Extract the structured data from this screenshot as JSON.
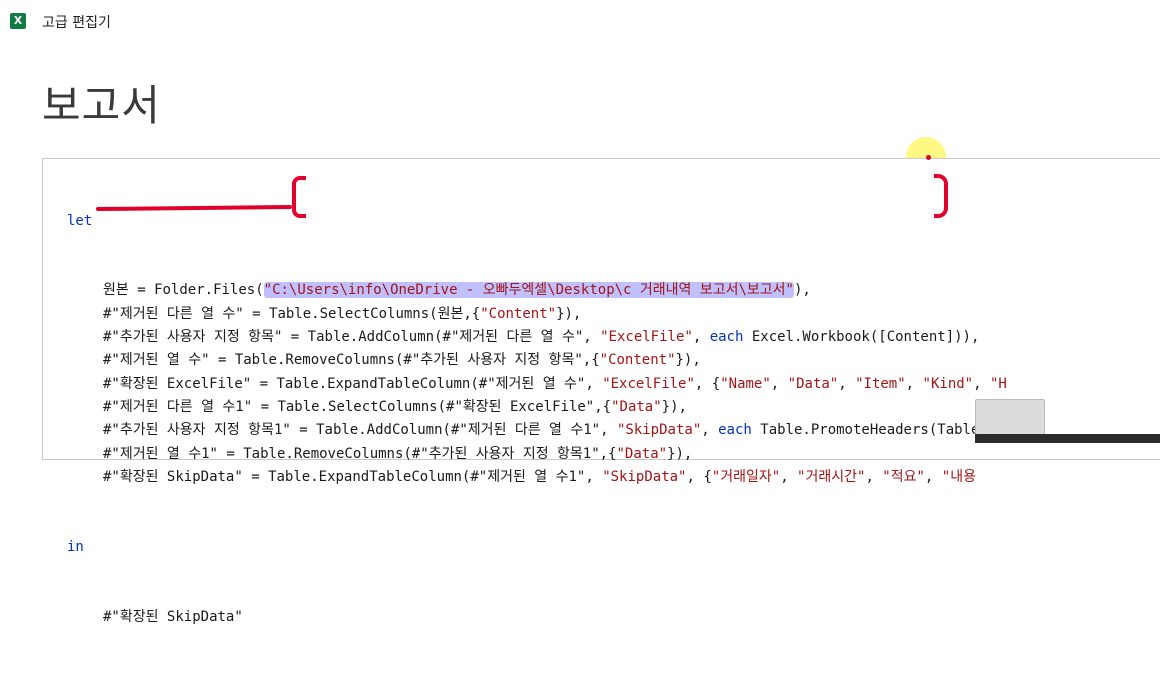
{
  "window": {
    "app_icon": "excel-icon",
    "app_icon_letter": "X",
    "title": "고급 편집기"
  },
  "query": {
    "name": "보고서"
  },
  "code": {
    "let": "let",
    "in": "in",
    "lines": [
      {
        "kind": "folder",
        "var": "원본",
        "eq": " = ",
        "fn": "Folder.Files(",
        "path": "\"C:\\Users\\info\\OneDrive - 오빠두엑셀\\Desktop\\c 거래내역 보고서\\보고서\"",
        "tail": "),"
      },
      {
        "kind": "plain",
        "parts": [
          [
            "t",
            "#\"제거된 다른 열 수\" = Table.SelectColumns(원본,{"
          ],
          [
            "s",
            "\"Content\""
          ],
          [
            "t",
            "}),"
          ]
        ]
      },
      {
        "kind": "plain",
        "parts": [
          [
            "t",
            "#\"추가된 사용자 지정 항목\" = Table.AddColumn(#\"제거된 다른 열 수\", "
          ],
          [
            "s",
            "\"ExcelFile\""
          ],
          [
            "t",
            ", "
          ],
          [
            "k",
            "each"
          ],
          [
            "t",
            " Excel.Workbook([Content])),"
          ]
        ]
      },
      {
        "kind": "plain",
        "parts": [
          [
            "t",
            "#\"제거된 열 수\" = Table.RemoveColumns(#\"추가된 사용자 지정 항목\",{"
          ],
          [
            "s",
            "\"Content\""
          ],
          [
            "t",
            "}),"
          ]
        ]
      },
      {
        "kind": "plain",
        "parts": [
          [
            "t",
            "#\"확장된 ExcelFile\" = Table.ExpandTableColumn(#\"제거된 열 수\", "
          ],
          [
            "s",
            "\"ExcelFile\""
          ],
          [
            "t",
            ", {"
          ],
          [
            "s",
            "\"Name\""
          ],
          [
            "t",
            ", "
          ],
          [
            "s",
            "\"Data\""
          ],
          [
            "t",
            ", "
          ],
          [
            "s",
            "\"Item\""
          ],
          [
            "t",
            ", "
          ],
          [
            "s",
            "\"Kind\""
          ],
          [
            "t",
            ", "
          ],
          [
            "s",
            "\"H"
          ]
        ]
      },
      {
        "kind": "plain",
        "parts": [
          [
            "t",
            "#\"제거된 다른 열 수1\" = Table.SelectColumns(#\"확장된 ExcelFile\",{"
          ],
          [
            "s",
            "\"Data\""
          ],
          [
            "t",
            "}),"
          ]
        ]
      },
      {
        "kind": "plain",
        "parts": [
          [
            "t",
            "#\"추가된 사용자 지정 항목1\" = Table.AddColumn(#\"제거된 다른 열 수1\", "
          ],
          [
            "s",
            "\"SkipData\""
          ],
          [
            "t",
            ", "
          ],
          [
            "k",
            "each"
          ],
          [
            "t",
            " Table.PromoteHeaders(Table."
          ]
        ]
      },
      {
        "kind": "plain",
        "parts": [
          [
            "t",
            "#\"제거된 열 수1\" = Table.RemoveColumns(#\"추가된 사용자 지정 항목1\",{"
          ],
          [
            "s",
            "\"Data\""
          ],
          [
            "t",
            "}),"
          ]
        ]
      },
      {
        "kind": "plain",
        "parts": [
          [
            "t",
            "#\"확장된 SkipData\" = Table.ExpandTableColumn(#\"제거된 열 수1\", "
          ],
          [
            "s",
            "\"SkipData\""
          ],
          [
            "t",
            ", {"
          ],
          [
            "s",
            "\"거래일자\""
          ],
          [
            "t",
            ", "
          ],
          [
            "s",
            "\"거래시간\""
          ],
          [
            "t",
            ", "
          ],
          [
            "s",
            "\"적요\""
          ],
          [
            "t",
            ", "
          ],
          [
            "s",
            "\"내용"
          ]
        ]
      }
    ],
    "result_line": "#\"확장된 SkipData\""
  },
  "colors": {
    "keyword": "#0033bb",
    "string": "#a31515",
    "path_highlight": "#8c8cff",
    "annotation_red": "#e0002a",
    "annotation_yellow": "#fff55a"
  }
}
